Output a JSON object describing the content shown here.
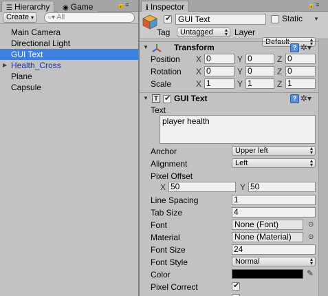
{
  "hierarchy": {
    "tab_label": "Hierarchy",
    "tab_icon": "hierarchy-icon",
    "create_label": "Create",
    "search_placeholder": "All",
    "items": [
      {
        "label": "Main Camera"
      },
      {
        "label": "Directional Light"
      },
      {
        "label": "GUI Text"
      },
      {
        "label": "Health_Cross"
      },
      {
        "label": "Plane"
      },
      {
        "label": "Capsule"
      }
    ],
    "selected_index": 2
  },
  "game_tab": {
    "label": "Game",
    "icon": "game-icon"
  },
  "inspector": {
    "tab_label": "Inspector",
    "tab_icon": "info-icon",
    "object_name": "GUI Text",
    "active": true,
    "static_label": "Static",
    "static_checked": false,
    "tag_label": "Tag",
    "tag_value": "Untagged",
    "layer_label": "Layer",
    "layer_value": "Default",
    "transform": {
      "title": "Transform",
      "position_label": "Position",
      "rotation_label": "Rotation",
      "scale_label": "Scale",
      "axis_x": "X",
      "axis_y": "Y",
      "axis_z": "Z",
      "position": {
        "x": "0",
        "y": "0",
        "z": "0"
      },
      "rotation": {
        "x": "0",
        "y": "0",
        "z": "0"
      },
      "scale": {
        "x": "1",
        "y": "1",
        "z": "1"
      }
    },
    "gui_text": {
      "title": "GUI Text",
      "enabled": true,
      "text_label": "Text",
      "text_value": "player health",
      "anchor_label": "Anchor",
      "anchor_value": "Upper left",
      "alignment_label": "Alignment",
      "alignment_value": "Left",
      "pixel_offset_label": "Pixel Offset",
      "pixel_offset": {
        "x": "50",
        "y": "50"
      },
      "line_spacing_label": "Line Spacing",
      "line_spacing_value": "1",
      "tab_size_label": "Tab Size",
      "tab_size_value": "4",
      "font_label": "Font",
      "font_value": "None (Font)",
      "material_label": "Material",
      "material_value": "None (Material)",
      "font_size_label": "Font Size",
      "font_size_value": "24",
      "font_style_label": "Font Style",
      "font_style_value": "Normal",
      "color_label": "Color",
      "color_value": "#000000",
      "pixel_correct_label": "Pixel Correct",
      "pixel_correct": true
    }
  },
  "colors": {
    "selection": "#3d80df",
    "prefab_text": "#1a2fa8",
    "panel_bg": "#c2c2c2"
  }
}
